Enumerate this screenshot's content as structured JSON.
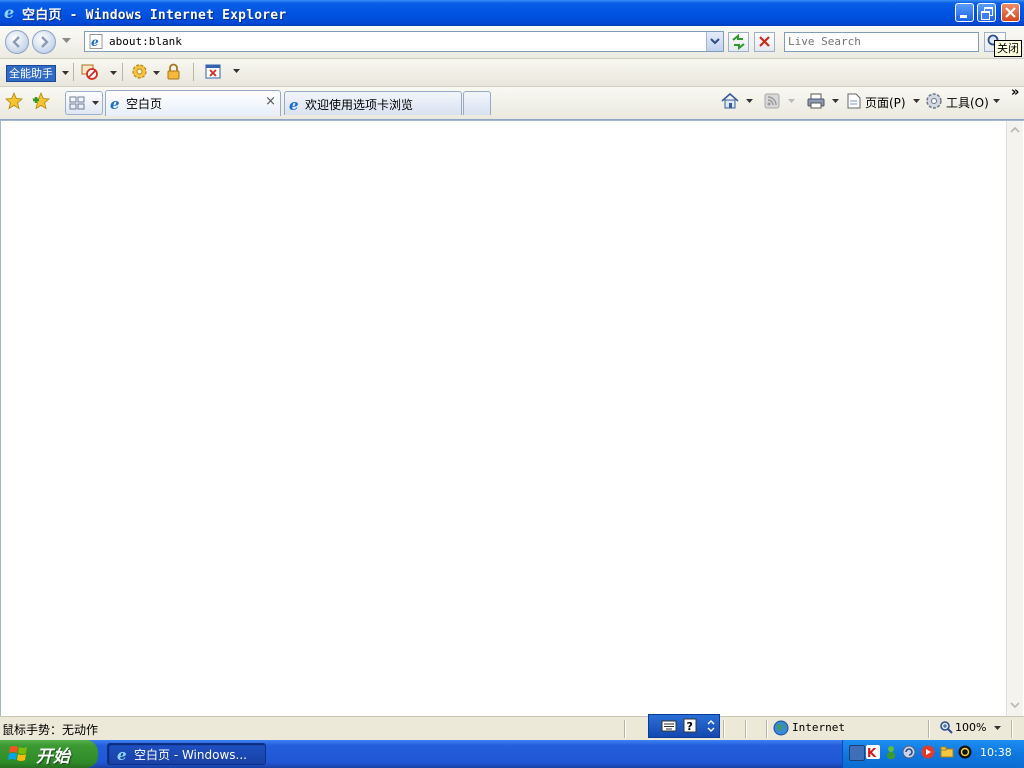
{
  "window": {
    "title": "空白页 - Windows Internet Explorer",
    "close_tooltip": "关闭"
  },
  "navbar": {
    "address": "about:blank",
    "search_placeholder": "Live Search"
  },
  "addon_bar": {
    "label": "全能助手"
  },
  "tabs": [
    {
      "label": "空白页",
      "active": true,
      "close": "×"
    },
    {
      "label": "欢迎使用选项卡浏览",
      "active": false
    }
  ],
  "command_bar": {
    "page_label": "页面(P)",
    "tools_label": "工具(O)",
    "overflow": "»"
  },
  "statusbar": {
    "text": "鼠标手势：无动作",
    "zone": "Internet",
    "zoom": "100%"
  },
  "taskbar": {
    "start_label": "开始",
    "task_label": "空白页 - Windows...",
    "clock": "10:38"
  },
  "colors": {
    "titlebar": "#0054e3",
    "taskbar": "#245edb",
    "start": "#3c9a33",
    "tray": "#0f78e2"
  }
}
